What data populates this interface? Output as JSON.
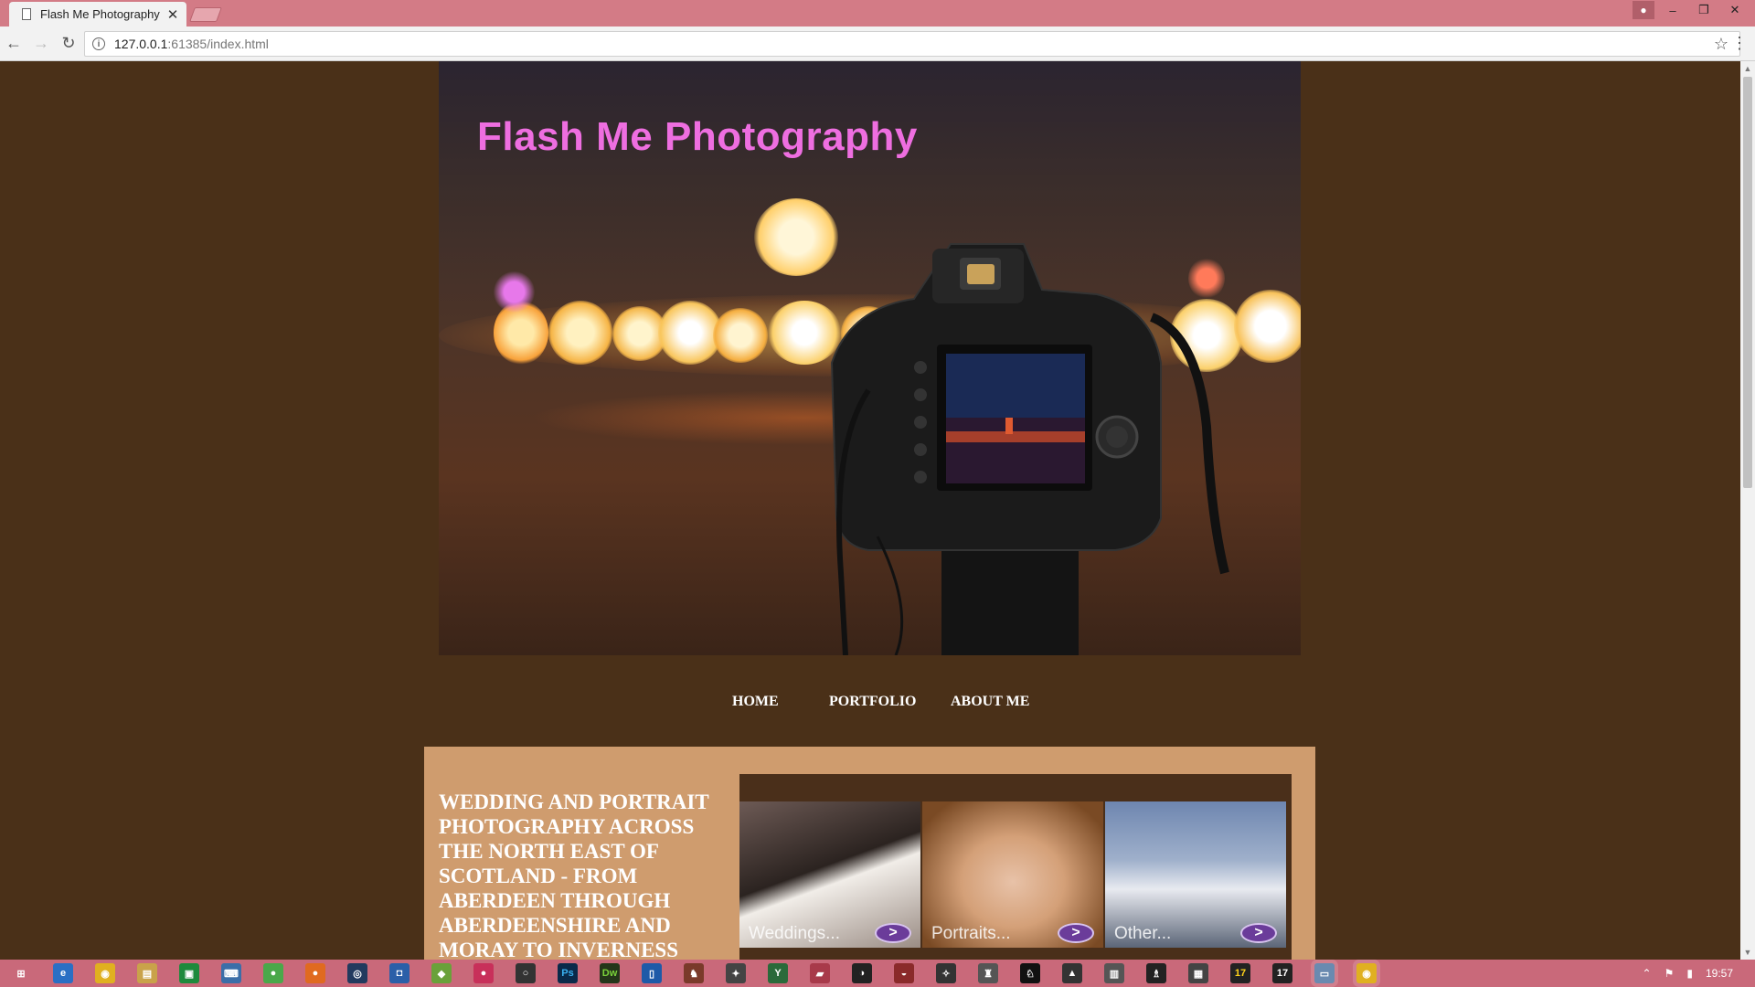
{
  "browser": {
    "tab_title": "Flash Me Photography",
    "tab_close": "✕",
    "url_host": "127.0.0.1",
    "url_rest": ":61385/index.html",
    "info_glyph": "i",
    "back_glyph": "←",
    "forward_glyph": "→",
    "reload_glyph": "↻",
    "star_glyph": "☆",
    "menu_glyph": "⋮",
    "window_controls": [
      "–",
      "❐",
      "✕"
    ]
  },
  "site": {
    "title": "Flash Me Photography",
    "nav": [
      {
        "label": "HOME"
      },
      {
        "label": "PORTFOLIO"
      },
      {
        "label": "ABOUT ME"
      }
    ],
    "intro": "WEDDING AND PORTRAIT PHOTOGRAPHY ACROSS THE NORTH EAST OF SCOTLAND - FROM ABERDEEN THROUGH ABERDEENSHIRE AND MORAY TO INVERNESS",
    "gallery": [
      {
        "label": "Weddings..."
      },
      {
        "label": "Portraits..."
      },
      {
        "label": "Other..."
      }
    ],
    "arrow_glyph": ">"
  },
  "taskbar": {
    "clock": "19:57"
  },
  "colors": {
    "page_bg": "#4a3018",
    "content_bg": "#cf9c6e",
    "title_pink": "#ee6ee0",
    "taskbar": "#c9697a"
  }
}
